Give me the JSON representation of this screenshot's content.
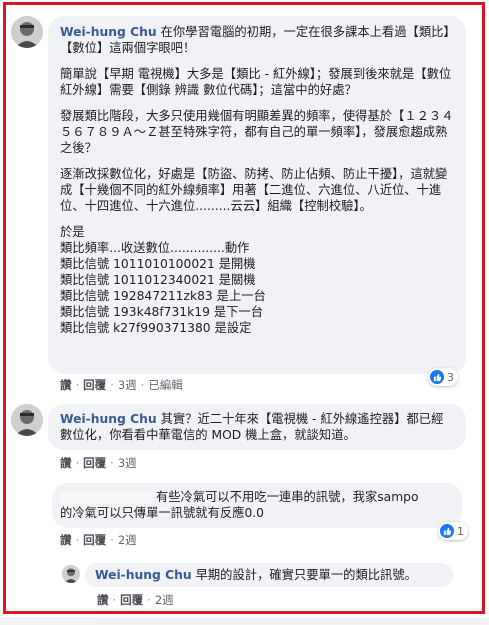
{
  "comment1": {
    "author": "Wei-hung Chu",
    "p1": " 在你學習電腦的初期，一定在很多課本上看過【類比】【數位】這兩個字眼吧！",
    "p2": "簡單說【早期 電視機】大多是【類比 - 紅外線】；發展到後來就是【數位紅外線】需要【側錄 辨識 數位代碼】；這當中的好處？",
    "p3": "發展類比階段，大多只使用幾個有明顯差異的頻率，使得基於【１２３４５６７８９Ａ～Ｚ甚至特殊字符，都有自己的單一頻率】，發展愈趨成熟之後？",
    "p4": "逐漸改採數位化，好處是【防盜、防拷、防止佔頻、防止干擾】，這就變成【十幾個不同的紅外線頻率】用著【二進位、六進位、八近位、十進位、十四進位、十六進位.........云云】組織【控制校驗】。",
    "p5": "於是\n類比頻率...收送數位..............動作\n類比信號 1011010100021 是開機\n類比信號 1011012340021 是關機\n類比信號 192847211zk83 是上一台\n類比信號 193k48f731k19 是下一台\n類比信號 k27f990371380 是設定",
    "actions": {
      "like": "讚",
      "reply": "回覆",
      "time": "3週",
      "edited": "已編輯"
    },
    "reaction_count": "3"
  },
  "comment2": {
    "author": "Wei-hung Chu",
    "text": " 其實？近二十年來【電視機 - 紅外線遙控器】都已經數位化，你看看中華電信的 MOD 機上盒，就談知道。",
    "actions": {
      "like": "讚",
      "reply": "回覆",
      "time": "3週"
    }
  },
  "comment3": {
    "text_line1": "有些冷氣可以不用吃一連串的訊號，我家sampo",
    "text_line2": "的冷氣可以只傳單一訊號就有反應0.0",
    "actions": {
      "like": "讚",
      "reply": "回覆",
      "time": "2週"
    },
    "reaction_count": "1"
  },
  "comment4": {
    "author": "Wei-hung Chu",
    "text": " 早期的設計，確實只要單一的類比訊號。",
    "actions": {
      "like": "讚",
      "reply": "回覆",
      "time": "2週"
    }
  },
  "colors": {
    "highlight_border": "#e0141e",
    "bubble": "#f0f2f5",
    "author": "#385898",
    "like": "#1877f2"
  },
  "icons": [
    "avatar",
    "like-icon"
  ]
}
